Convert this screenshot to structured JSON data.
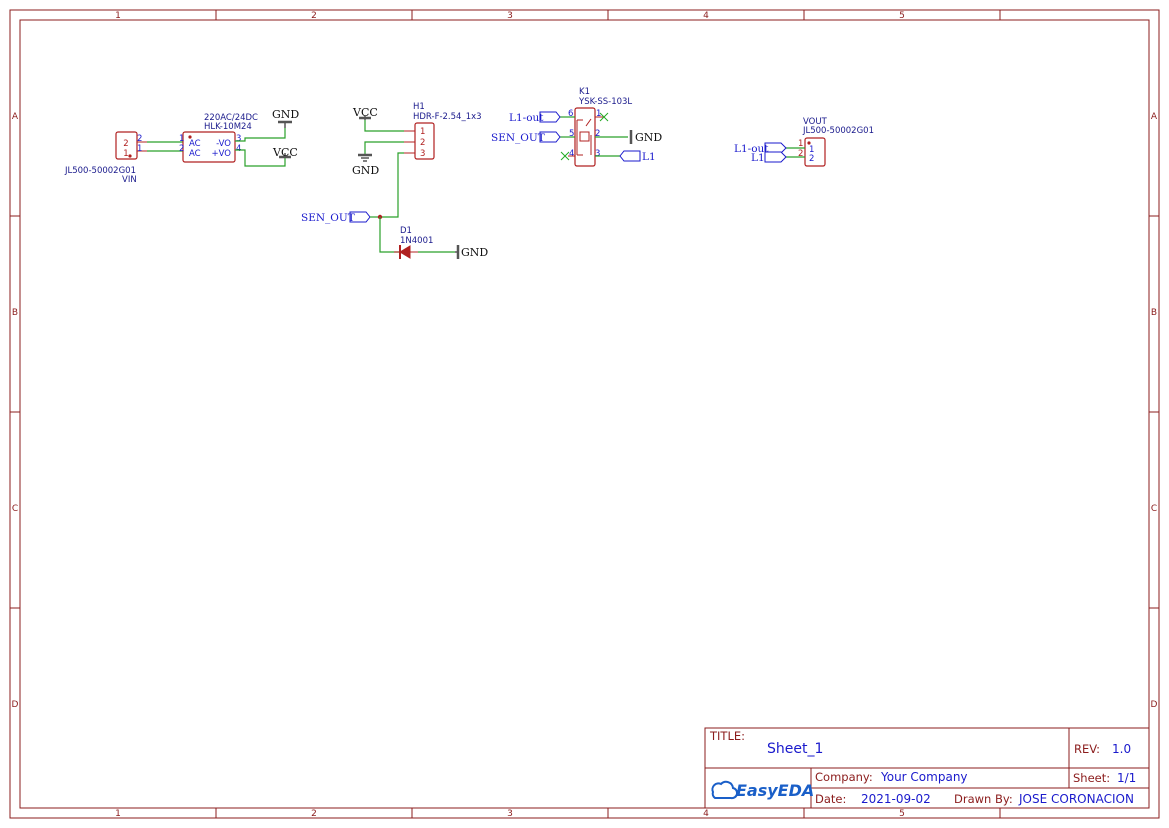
{
  "frame": {
    "columns": [
      "1",
      "2",
      "3",
      "4",
      "5"
    ],
    "rows": [
      "A",
      "B",
      "C",
      "D"
    ]
  },
  "components": {
    "vin": {
      "ref": "VIN",
      "value": "JL500-50002G01",
      "pins": [
        "2",
        "1"
      ]
    },
    "hlk": {
      "value1": "220AC/24DC",
      "value2": "HLK-10M24",
      "pins_left": [
        "1",
        "2"
      ],
      "pins_right": [
        "3",
        "4"
      ],
      "labels_left": [
        "AC",
        "AC"
      ],
      "labels_right": [
        "-VO",
        "+VO"
      ]
    },
    "h1": {
      "ref": "H1",
      "value": "HDR-F-2.54_1x3",
      "pins": [
        "1",
        "2",
        "3"
      ]
    },
    "d1": {
      "ref": "D1",
      "value": "1N4001"
    },
    "k1": {
      "ref": "K1",
      "value": "YSK-SS-103L",
      "pins": [
        "6",
        "1",
        "5",
        "2",
        "4",
        "3"
      ]
    },
    "vout": {
      "ref": "VOUT",
      "value": "JL500-50002G01",
      "pins": [
        "1",
        "2"
      ]
    }
  },
  "power": {
    "gnd": "GND",
    "vcc": "VCC"
  },
  "nets": {
    "sen_out": "SEN_OUT",
    "l1_out": "L1-out",
    "l1": "L1"
  },
  "title_block": {
    "title_label": "TITLE:",
    "title": "Sheet_1",
    "rev_label": "REV:",
    "rev": "1.0",
    "logo_text": "EasyEDA",
    "company_label": "Company:",
    "company": "Your Company",
    "sheet_label": "Sheet:",
    "sheet": "1/1",
    "date_label": "Date:",
    "date": "2021-09-02",
    "drawn_label": "Drawn By:",
    "drawn_by": "JOSE CORONACION"
  },
  "colors": {
    "frame": "#8b1c1c",
    "wire": "#2aa02a",
    "component": "#b02020",
    "net_label": "#1a1acc"
  }
}
